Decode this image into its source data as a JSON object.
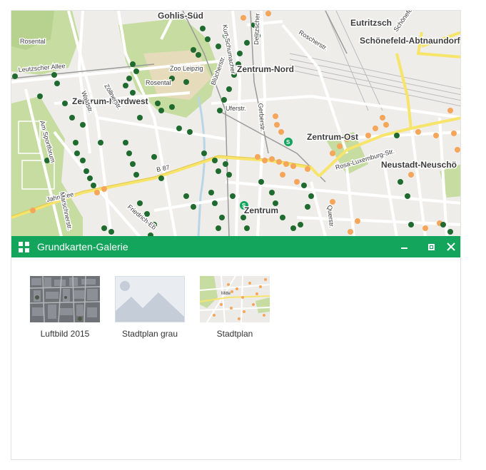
{
  "map": {
    "labels": {
      "gohlis_sued": "Gohlis-Süd",
      "eutritzsch": "Eutritzsch",
      "schoenefeld": "Schönefeld-Abtnaundorf",
      "rosental_top": "Rosental",
      "leutzscher_allee": "Leutzscher Allee",
      "zoo_leipzig": "Zoo Leipzig",
      "rosental": "Rosental",
      "zentrum_nord": "Zentrum-Nord",
      "zentrum_nordwest": "Zentrum-Nordwest",
      "zentrum_ost": "Zentrum-Ost",
      "neustadt": "Neustadt-Neuschö",
      "zentrum": "Zentrum",
      "b87": "B 87",
      "jahnallee": "Jahnallee",
      "rosa_luxemburg": "Rosa-Luxemburg-Str.",
      "am_sportforum": "Am Sportforum",
      "marschner": "Marschnerstr.",
      "gerberstr": "Gerberstr.",
      "roscherstr": "Roscherstr.",
      "uferstr": "Uferstr.",
      "querstr": "Querstr.",
      "zollnerstr": "Zöllnerstr.",
      "waldstr": "Waldstr.",
      "friedrich_ebert": "Friedrich-Eb",
      "bluecher": "Blücherstr.",
      "delitzscher": "Delitzscher",
      "kurt_schumacher": "Kurt-Schumacher",
      "schoenefelder": "Schönefelder"
    },
    "colors": {
      "park": "#c6dca0",
      "street_major": "#f7e46b",
      "tree_point": "#1f6b2f",
      "construction_point": "#f5a65b",
      "water": "#b9d6e6"
    }
  },
  "panel": {
    "title": "Grundkarten-Galerie",
    "icon": "grid-icon",
    "minimize_icon": "minimize-icon",
    "maximize_icon": "maximize-icon",
    "close_icon": "close-icon",
    "header_color": "#13a55b"
  },
  "gallery": {
    "items": [
      {
        "label": "Luftbild 2015",
        "thumbnail": "aerial-photo"
      },
      {
        "label": "Stadtplan grau",
        "thumbnail": "placeholder-image"
      },
      {
        "label": "Stadtplan",
        "thumbnail": "city-map",
        "thumb_text": "Mitte"
      }
    ]
  }
}
